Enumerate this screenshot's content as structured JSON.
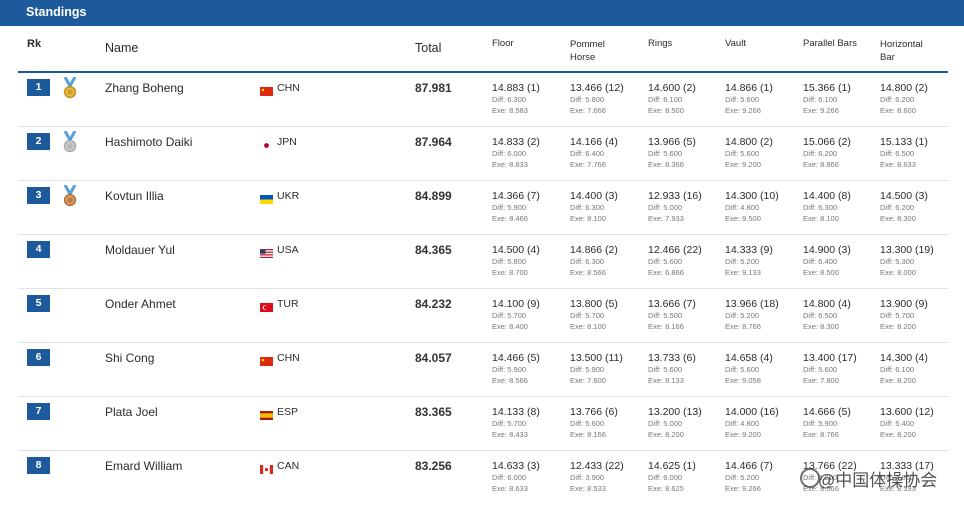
{
  "header": {
    "title": "Standings"
  },
  "columns": {
    "rk": "Rk",
    "name": "Name",
    "total": "Total",
    "apparatus": [
      "Floor",
      "Pommel Horse",
      "Rings",
      "Vault",
      "Parallel Bars",
      "Horizontal Bar"
    ]
  },
  "colors": {
    "accent": "#1c5a9c",
    "gold": "#d4a017",
    "silver": "#b8b8b8",
    "bronze": "#c47a3a"
  },
  "rows": [
    {
      "rank": "1",
      "medal": "gold",
      "name": "Zhang Boheng",
      "flag": "CN",
      "nation": "CHN",
      "total": "87.981",
      "scores": [
        {
          "score": "14.883 (1)",
          "diff": "Diff: 6.300",
          "exe": "Exe: 8.583"
        },
        {
          "score": "13.466 (12)",
          "diff": "Diff: 5.800",
          "exe": "Exe: 7.666"
        },
        {
          "score": "14.600 (2)",
          "diff": "Diff: 6.100",
          "exe": "Exe: 8.500"
        },
        {
          "score": "14.866 (1)",
          "diff": "Diff: 5.600",
          "exe": "Exe: 9.266"
        },
        {
          "score": "15.366 (1)",
          "diff": "Diff: 6.100",
          "exe": "Exe: 9.266"
        },
        {
          "score": "14.800 (2)",
          "diff": "Diff: 6.200",
          "exe": "Exe: 8.600"
        }
      ]
    },
    {
      "rank": "2",
      "medal": "silver",
      "name": "Hashimoto Daiki",
      "flag": "JP",
      "nation": "JPN",
      "total": "87.964",
      "scores": [
        {
          "score": "14.833 (2)",
          "diff": "Diff: 6.000",
          "exe": "Exe: 8.833"
        },
        {
          "score": "14.166 (4)",
          "diff": "Diff: 6.400",
          "exe": "Exe: 7.766"
        },
        {
          "score": "13.966 (5)",
          "diff": "Diff: 5.600",
          "exe": "Exe: 8.366"
        },
        {
          "score": "14.800 (2)",
          "diff": "Diff: 5.600",
          "exe": "Exe: 9.200"
        },
        {
          "score": "15.066 (2)",
          "diff": "Diff: 6.200",
          "exe": "Exe: 8.866"
        },
        {
          "score": "15.133 (1)",
          "diff": "Diff: 6.500",
          "exe": "Exe: 8.633"
        }
      ]
    },
    {
      "rank": "3",
      "medal": "bronze",
      "name": "Kovtun Illia",
      "flag": "UA",
      "nation": "UKR",
      "total": "84.899",
      "scores": [
        {
          "score": "14.366 (7)",
          "diff": "Diff: 5.900",
          "exe": "Exe: 8.466"
        },
        {
          "score": "14.400 (3)",
          "diff": "Diff: 6.300",
          "exe": "Exe: 8.100"
        },
        {
          "score": "12.933 (16)",
          "diff": "Diff: 5.000",
          "exe": "Exe: 7.933"
        },
        {
          "score": "14.300 (10)",
          "diff": "Diff: 4.800",
          "exe": "Exe: 9.500"
        },
        {
          "score": "14.400 (8)",
          "diff": "Diff: 6.300",
          "exe": "Exe: 8.100"
        },
        {
          "score": "14.500 (3)",
          "diff": "Diff: 6.200",
          "exe": "Exe: 8.300"
        }
      ]
    },
    {
      "rank": "4",
      "medal": "",
      "name": "Moldauer Yul",
      "flag": "US",
      "nation": "USA",
      "total": "84.365",
      "scores": [
        {
          "score": "14.500 (4)",
          "diff": "Diff: 5.800",
          "exe": "Exe: 8.700"
        },
        {
          "score": "14.866 (2)",
          "diff": "Diff: 6.300",
          "exe": "Exe: 8.566"
        },
        {
          "score": "12.466 (22)",
          "diff": "Diff: 5.600",
          "exe": "Exe: 6.866"
        },
        {
          "score": "14.333 (9)",
          "diff": "Diff: 5.200",
          "exe": "Exe: 9.133"
        },
        {
          "score": "14.900 (3)",
          "diff": "Diff: 6.400",
          "exe": "Exe: 8.500"
        },
        {
          "score": "13.300 (19)",
          "diff": "Diff: 5.300",
          "exe": "Exe: 8.000"
        }
      ]
    },
    {
      "rank": "5",
      "medal": "",
      "name": "Onder Ahmet",
      "flag": "TR",
      "nation": "TUR",
      "total": "84.232",
      "scores": [
        {
          "score": "14.100 (9)",
          "diff": "Diff: 5.700",
          "exe": "Exe: 8.400"
        },
        {
          "score": "13.800 (5)",
          "diff": "Diff: 5.700",
          "exe": "Exe: 8.100"
        },
        {
          "score": "13.666 (7)",
          "diff": "Diff: 5.500",
          "exe": "Exe: 8.166"
        },
        {
          "score": "13.966 (18)",
          "diff": "Diff: 5.200",
          "exe": "Exe: 8.766"
        },
        {
          "score": "14.800 (4)",
          "diff": "Diff: 6.500",
          "exe": "Exe: 8.300"
        },
        {
          "score": "13.900 (9)",
          "diff": "Diff: 5.700",
          "exe": "Exe: 8.200"
        }
      ]
    },
    {
      "rank": "6",
      "medal": "",
      "name": "Shi Cong",
      "flag": "CN",
      "nation": "CHN",
      "total": "84.057",
      "scores": [
        {
          "score": "14.466 (5)",
          "diff": "Diff: 5.900",
          "exe": "Exe: 8.566"
        },
        {
          "score": "13.500 (11)",
          "diff": "Diff: 5.900",
          "exe": "Exe: 7.600"
        },
        {
          "score": "13.733 (6)",
          "diff": "Diff: 5.600",
          "exe": "Exe: 8.133"
        },
        {
          "score": "14.658 (4)",
          "diff": "Diff: 5.600",
          "exe": "Exe: 9.058"
        },
        {
          "score": "13.400 (17)",
          "diff": "Diff: 5.600",
          "exe": "Exe: 7.800"
        },
        {
          "score": "14.300 (4)",
          "diff": "Diff: 6.100",
          "exe": "Exe: 8.200"
        }
      ]
    },
    {
      "rank": "7",
      "medal": "",
      "name": "Plata Joel",
      "flag": "ES",
      "nation": "ESP",
      "total": "83.365",
      "scores": [
        {
          "score": "14.133 (8)",
          "diff": "Diff: 5.700",
          "exe": "Exe: 8.433"
        },
        {
          "score": "13.766 (6)",
          "diff": "Diff: 5.600",
          "exe": "Exe: 8.166"
        },
        {
          "score": "13.200 (13)",
          "diff": "Diff: 5.000",
          "exe": "Exe: 8.200"
        },
        {
          "score": "14.000 (16)",
          "diff": "Diff: 4.800",
          "exe": "Exe: 9.200"
        },
        {
          "score": "14.666 (5)",
          "diff": "Diff: 5.900",
          "exe": "Exe: 8.766"
        },
        {
          "score": "13.600 (12)",
          "diff": "Diff: 5.400",
          "exe": "Exe: 8.200"
        }
      ]
    },
    {
      "rank": "8",
      "medal": "",
      "name": "Emard William",
      "flag": "CA",
      "nation": "CAN",
      "total": "83.256",
      "scores": [
        {
          "score": "14.633 (3)",
          "diff": "Diff: 6.000",
          "exe": "Exe: 8.633"
        },
        {
          "score": "12.433 (22)",
          "diff": "Diff: 3.900",
          "exe": "Exe: 8.533"
        },
        {
          "score": "14.625 (1)",
          "diff": "Diff: 6.000",
          "exe": "Exe: 8.625"
        },
        {
          "score": "14.466 (7)",
          "diff": "Diff: 5.200",
          "exe": "Exe: 9.266"
        },
        {
          "score": "13.766 (22)",
          "diff": "Diff: 5.200",
          "exe": "Exe: 8.566"
        },
        {
          "score": "13.333 (17)",
          "diff": "Diff: 4.800",
          "exe": "Exe: 8.533"
        }
      ]
    }
  ],
  "watermark": "@中国体操协会"
}
